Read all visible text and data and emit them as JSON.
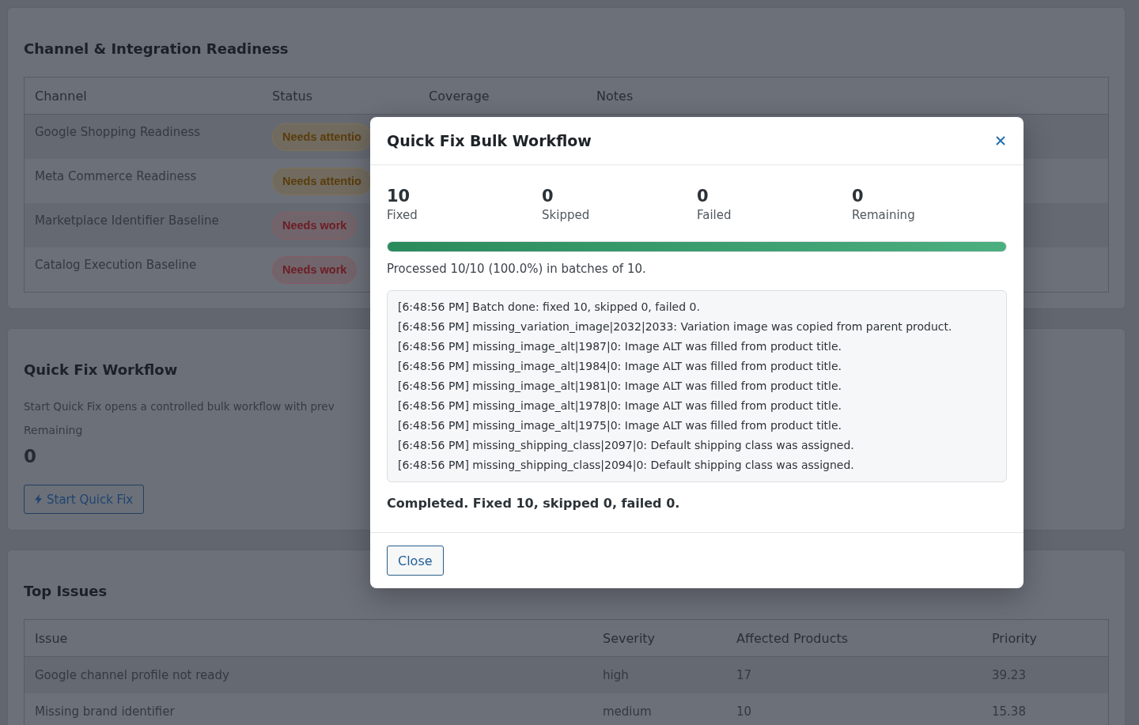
{
  "readiness": {
    "title": "Channel & Integration Readiness",
    "columns": [
      "Channel",
      "Status",
      "Coverage",
      "Notes"
    ],
    "rows": [
      {
        "channel": "Google Shopping Readiness",
        "status": {
          "label": "Needs attentio",
          "kind": "warning"
        }
      },
      {
        "channel": "Meta Commerce Readiness",
        "status": {
          "label": "Needs attentio",
          "kind": "warning"
        }
      },
      {
        "channel": "Marketplace Identifier Baseline",
        "status": {
          "label": "Needs work",
          "kind": "danger"
        }
      },
      {
        "channel": "Catalog Execution Baseline",
        "status": {
          "label": "Needs work",
          "kind": "danger"
        }
      }
    ]
  },
  "quick_fix": {
    "title": "Quick Fix Workflow",
    "description": "Start Quick Fix opens a controlled bulk workflow with prev",
    "remaining_label": "Remaining",
    "remaining_value": "0",
    "start_button": "Start Quick Fix"
  },
  "top_issues": {
    "title": "Top Issues",
    "columns": [
      "Issue",
      "Severity",
      "Affected Products",
      "Priority"
    ],
    "rows": [
      [
        "Google channel profile not ready",
        "high",
        "17",
        "39.23"
      ],
      [
        "Missing brand identifier",
        "medium",
        "10",
        "15.38"
      ]
    ]
  },
  "modal": {
    "title": "Quick Fix Bulk Workflow",
    "stats": [
      {
        "value": "10",
        "label": "Fixed"
      },
      {
        "value": "0",
        "label": "Skipped"
      },
      {
        "value": "0",
        "label": "Failed"
      },
      {
        "value": "0",
        "label": "Remaining"
      }
    ],
    "progress": {
      "level": 1
    },
    "progress_text": "Processed 10/10 (100.0%) in batches of 10.",
    "log": [
      "[6:48:56 PM] Batch done: fixed 10, skipped 0, failed 0.",
      "[6:48:56 PM] missing_variation_image|2032|2033: Variation image was copied from parent product.",
      "[6:48:56 PM] missing_image_alt|1987|0: Image ALT was filled from product title.",
      "[6:48:56 PM] missing_image_alt|1984|0: Image ALT was filled from product title.",
      "[6:48:56 PM] missing_image_alt|1981|0: Image ALT was filled from product title.",
      "[6:48:56 PM] missing_image_alt|1978|0: Image ALT was filled from product title.",
      "[6:48:56 PM] missing_image_alt|1975|0: Image ALT was filled from product title.",
      "[6:48:56 PM] missing_shipping_class|2097|0: Default shipping class was assigned.",
      "[6:48:56 PM] missing_shipping_class|2094|0: Default shipping class was assigned."
    ],
    "summary": "Completed. Fixed 10, skipped 0, failed 0.",
    "close_button": "Close"
  }
}
